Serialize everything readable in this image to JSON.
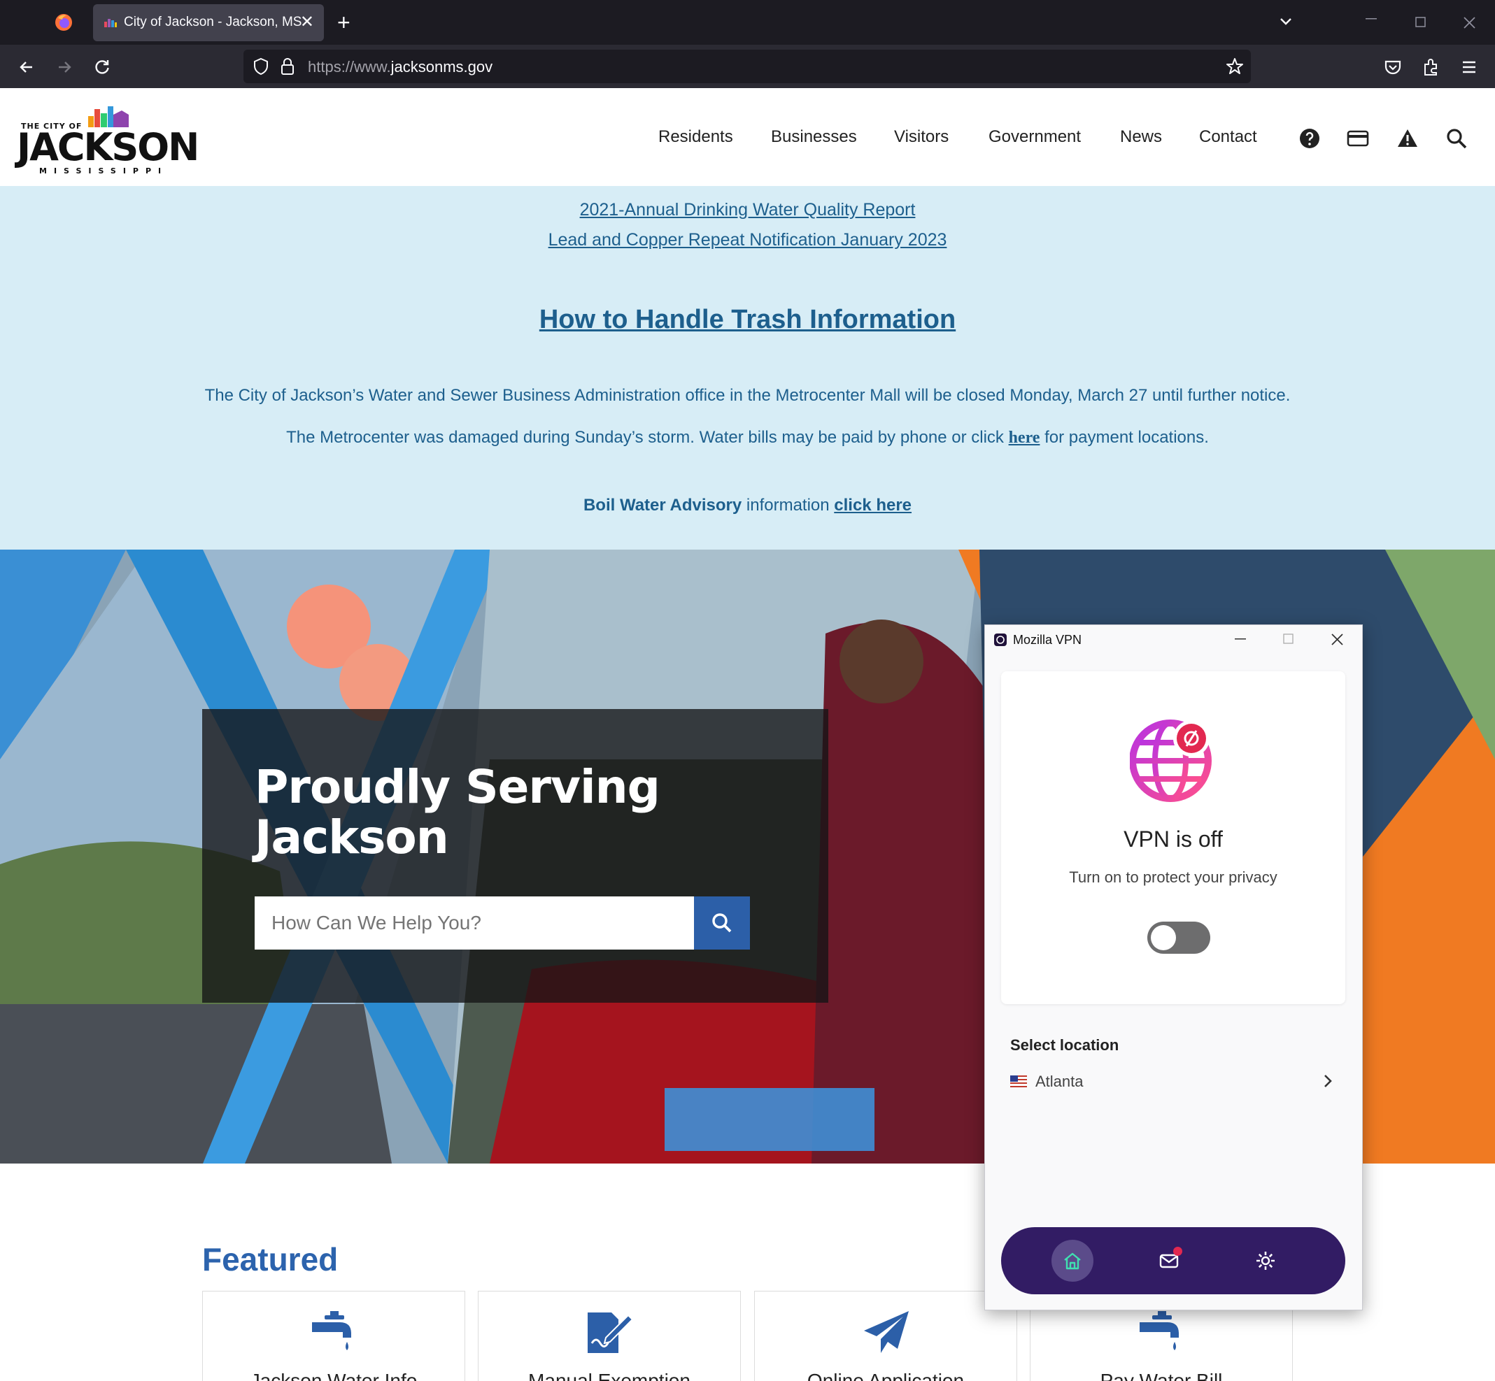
{
  "browser": {
    "tab_title": "City of Jackson - Jackson, MS",
    "url_prefix": "https://www.",
    "url_domain": "jacksonms.gov",
    "close_tab": "✕",
    "new_tab": "+"
  },
  "site": {
    "logo": {
      "small": "THE CITY OF",
      "big": "JACKSON",
      "sub": "MISSISSIPPI"
    },
    "nav": [
      "Residents",
      "Businesses",
      "Visitors",
      "Government",
      "News",
      "Contact"
    ],
    "alerts": {
      "link1": "2021-Annual Drinking Water Quality Report",
      "link2": "Lead and Copper Repeat Notification January 2023",
      "heading": "How to Handle Trash Information",
      "p1": "The City of Jackson’s Water and Sewer Business Administration office in the Metrocenter Mall will be closed Monday, March 27 until further notice.",
      "p2_before": "The Metrocenter was damaged during Sunday’s storm. Water bills may be paid by phone or click ",
      "p2_link": "here",
      "p2_after": " for payment locations.",
      "boil_bold": "Boil Water Advisory",
      "boil_mid": " information ",
      "boil_link": "click here"
    },
    "hero": {
      "title": "Proudly Serving Jackson",
      "search_placeholder": "How Can We Help You?"
    },
    "featured": {
      "heading": "Featured",
      "cards": [
        "Jackson Water Info",
        "Manual Exemption",
        "Online Application",
        "Pay Water Bill"
      ]
    }
  },
  "vpn": {
    "window_title": "Mozilla VPN",
    "status": "VPN is off",
    "subtitle": "Turn on to protect your privacy",
    "toggle_on": false,
    "select_location": "Select location",
    "location": "Atlanta",
    "dock": [
      "home-icon",
      "messages-icon",
      "settings-icon"
    ]
  },
  "colors": {
    "alert_bg": "#d7edf6",
    "link": "#1d5f8d",
    "featured": "#2c63ad",
    "vpn_dock": "#321c64"
  }
}
